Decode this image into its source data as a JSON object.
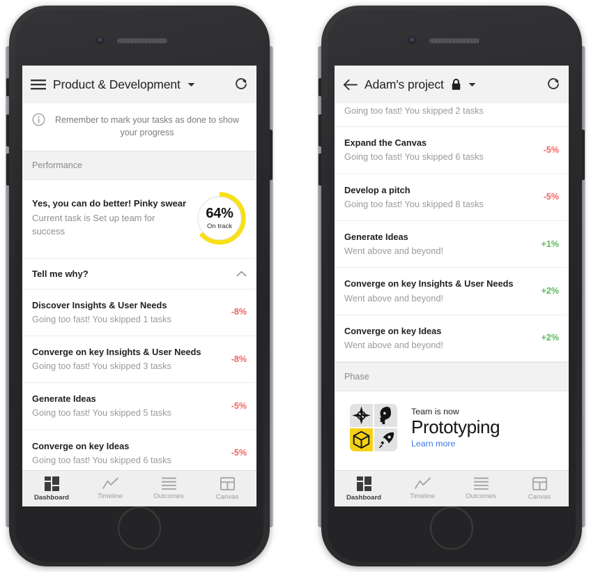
{
  "phones": [
    {
      "id": "left",
      "appbar": {
        "menu_icon": "hamburger-menu-icon",
        "title": "Product & Development",
        "dropdown_icon": "caret-down-icon",
        "refresh_icon": "refresh-icon"
      },
      "banner": {
        "icon": "info-circle-icon",
        "text": "Remember to mark your tasks as done to show your progress"
      },
      "section_label": "Performance",
      "performance": {
        "headline": "Yes, you can do better! Pinky swear",
        "subtext": "Current task is Set up team for success",
        "percent_label": "64%",
        "percent_value": 64,
        "status_label": "On track",
        "ring_color": "#f7e017",
        "ring_track_color": "#e8e8e8"
      },
      "collapse": {
        "label": "Tell me why?",
        "icon": "chevron-up-icon",
        "expanded": true
      },
      "tasks": [
        {
          "title": "Discover Insights & User Needs",
          "subtitle": "Going too fast! You skipped 1 tasks",
          "delta": "-8%",
          "tone": "neg"
        },
        {
          "title": "Converge on key Insights & User Needs",
          "subtitle": "Going too fast! You skipped 3 tasks",
          "delta": "-8%",
          "tone": "neg"
        },
        {
          "title": "Generate Ideas",
          "subtitle": "Going too fast! You skipped 5 tasks",
          "delta": "-5%",
          "tone": "neg"
        },
        {
          "title": "Converge on key Ideas",
          "subtitle": "Going too fast! You skipped 6 tasks",
          "delta": "-5%",
          "tone": "neg"
        }
      ],
      "bottom_nav": [
        {
          "label": "Dashboard",
          "icon": "dashboard-grid-icon",
          "active": true
        },
        {
          "label": "Timeline",
          "icon": "timeline-chart-icon",
          "active": false
        },
        {
          "label": "Outcomes",
          "icon": "outcomes-list-icon",
          "active": false
        },
        {
          "label": "Canvas",
          "icon": "canvas-table-icon",
          "active": false
        }
      ]
    },
    {
      "id": "right",
      "appbar": {
        "back_icon": "back-arrow-icon",
        "title": "Adam's project",
        "lock_icon": "lock-icon",
        "dropdown_icon": "caret-down-icon",
        "refresh_icon": "refresh-icon"
      },
      "partial_top_row": {
        "subtitle": "Going too fast! You skipped 2 tasks"
      },
      "tasks": [
        {
          "title": "Expand the Canvas",
          "subtitle": "Going too fast! You skipped 6 tasks",
          "delta": "-5%",
          "tone": "neg"
        },
        {
          "title": "Develop a pitch",
          "subtitle": "Going too fast! You skipped 8 tasks",
          "delta": "-5%",
          "tone": "neg"
        },
        {
          "title": "Generate Ideas",
          "subtitle": "Went above and beyond!",
          "delta": "+1%",
          "tone": "pos"
        },
        {
          "title": "Converge on key Insights & User Needs",
          "subtitle": "Went above and beyond!",
          "delta": "+2%",
          "tone": "pos"
        },
        {
          "title": "Converge on key Ideas",
          "subtitle": "Went above and beyond!",
          "delta": "+2%",
          "tone": "pos"
        }
      ],
      "section_label": "Phase",
      "phase": {
        "eyebrow": "Team is now",
        "name": "Prototyping",
        "link": "Learn more",
        "link_color": "#3b78e7",
        "active_color": "#f5d017",
        "icons": [
          {
            "name": "compass-icon",
            "active": false
          },
          {
            "name": "head-profile-icon",
            "active": false
          },
          {
            "name": "cube-3d-icon",
            "active": true
          },
          {
            "name": "rocket-icon",
            "active": false
          }
        ]
      },
      "bottom_nav": [
        {
          "label": "Dashboard",
          "icon": "dashboard-grid-icon",
          "active": true
        },
        {
          "label": "Timeline",
          "icon": "timeline-chart-icon",
          "active": false
        },
        {
          "label": "Outcomes",
          "icon": "outcomes-list-icon",
          "active": false
        },
        {
          "label": "Canvas",
          "icon": "canvas-table-icon",
          "active": false
        }
      ]
    }
  ]
}
